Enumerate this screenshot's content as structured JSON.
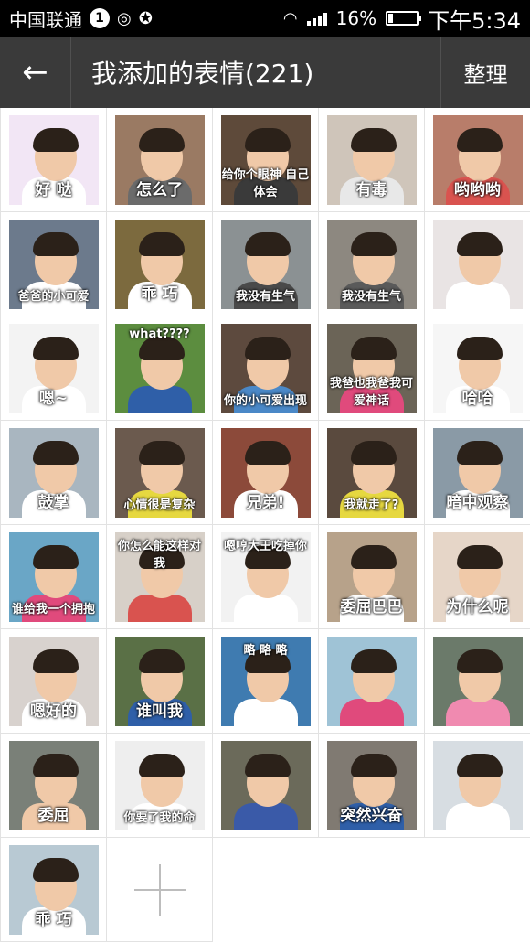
{
  "status": {
    "carrier": "中国联通",
    "notif_count": "1",
    "battery": "16%",
    "battery_level": 0.16,
    "time": "下午5:34"
  },
  "header": {
    "back_icon": "←",
    "title": "我添加的表情(221)",
    "manage_label": "整理"
  },
  "colors": {
    "titlebar": "#3a3a3a",
    "grid_line": "#e2e2e2"
  },
  "stickers": [
    {
      "caption": "好 哒",
      "bg": "#f2e6f5",
      "shirt": "#ffffff"
    },
    {
      "caption": "怎么了",
      "bg": "#9a7a63",
      "shirt": "#6b6b6b"
    },
    {
      "caption": "给你个眼神 自己体会",
      "bg": "#5e4a3a",
      "shirt": "#3a3a3a"
    },
    {
      "caption": "有毒",
      "bg": "#cfc5ba",
      "shirt": "#e8e8e8"
    },
    {
      "caption": "哟哟哟",
      "bg": "#b87d6a",
      "shirt": "#d9534f"
    },
    {
      "caption": "爸爸的小可爱",
      "bg": "#6c7a8c",
      "shirt": "#ffffff"
    },
    {
      "caption": "乖 巧",
      "bg": "#7c6a3e",
      "shirt": "#ffffff"
    },
    {
      "caption": "我没有生气",
      "bg": "#8b9193",
      "shirt": "#4a4a4a"
    },
    {
      "caption": "我没有生气",
      "bg": "#8d8880",
      "shirt": "#5a5a5a"
    },
    {
      "caption": "",
      "bg": "#e9e4e4",
      "shirt": "#ffffff"
    },
    {
      "caption": "嗯~",
      "bg": "#f3f3f3",
      "shirt": "#ffffff"
    },
    {
      "caption": "what????",
      "bg": "#5c8d3f",
      "shirt": "#2f5fa8"
    },
    {
      "caption": "你的小可爱出现",
      "bg": "#5d4a3e",
      "shirt": "#4a88c7"
    },
    {
      "caption": "我爸也我爸我可爱神话",
      "bg": "#6b6457",
      "shirt": "#e04a7c"
    },
    {
      "caption": "哈哈",
      "bg": "#f6f6f6",
      "shirt": "#ffffff"
    },
    {
      "caption": "鼓掌",
      "bg": "#a9b6c0",
      "shirt": "#ffffff"
    },
    {
      "caption": "心情很是复杂",
      "bg": "#6b5a4e",
      "shirt": "#e6d840"
    },
    {
      "caption": "兄弟!",
      "bg": "#8c4a3a",
      "shirt": "#ffffff"
    },
    {
      "caption": "我就走了?",
      "bg": "#5a4a3e",
      "shirt": "#e6d840"
    },
    {
      "caption": "暗中观察",
      "bg": "#8a9aa6",
      "shirt": "#ffffff"
    },
    {
      "caption": "谁给我一个拥抱",
      "bg": "#6aa6c6",
      "shirt": "#e04a7c"
    },
    {
      "caption": "你怎么能这样对我",
      "bg": "#d7d0c8",
      "shirt": "#d9534f"
    },
    {
      "caption": "嗯哼大王吃掉你",
      "bg": "#f2f2f2",
      "shirt": "#ffffff"
    },
    {
      "caption": "委屈巴巴",
      "bg": "#b7a28a",
      "shirt": "#ffffff"
    },
    {
      "caption": "为什么呢",
      "bg": "#e6d6c8",
      "shirt": "#ffffff"
    },
    {
      "caption": "嗯好的",
      "bg": "#d8d2ce",
      "shirt": "#ffffff"
    },
    {
      "caption": "谁叫我",
      "bg": "#5a7046",
      "shirt": "#2f5fa8"
    },
    {
      "caption": "略 略 略",
      "bg": "#3f7bb0",
      "shirt": "#ffffff"
    },
    {
      "caption": "",
      "bg": "#9fc3d6",
      "shirt": "#e04a7c"
    },
    {
      "caption": "",
      "bg": "#6b7a6a",
      "shirt": "#f08ab0"
    },
    {
      "caption": "委屈",
      "bg": "#7a8078",
      "shirt": "#f0c9a8"
    },
    {
      "caption": "你要了我的命",
      "bg": "#eeeeee",
      "shirt": "#ffffff"
    },
    {
      "caption": "",
      "bg": "#6b6a5a",
      "shirt": "#3a5aa8"
    },
    {
      "caption": "突然兴奋",
      "bg": "#807a72",
      "shirt": "#2f5fa8"
    },
    {
      "caption": "",
      "bg": "#d7dde2",
      "shirt": "#ffffff"
    },
    {
      "caption": "乖 巧",
      "bg": "#b8c9d3",
      "shirt": "#ffffff"
    }
  ]
}
